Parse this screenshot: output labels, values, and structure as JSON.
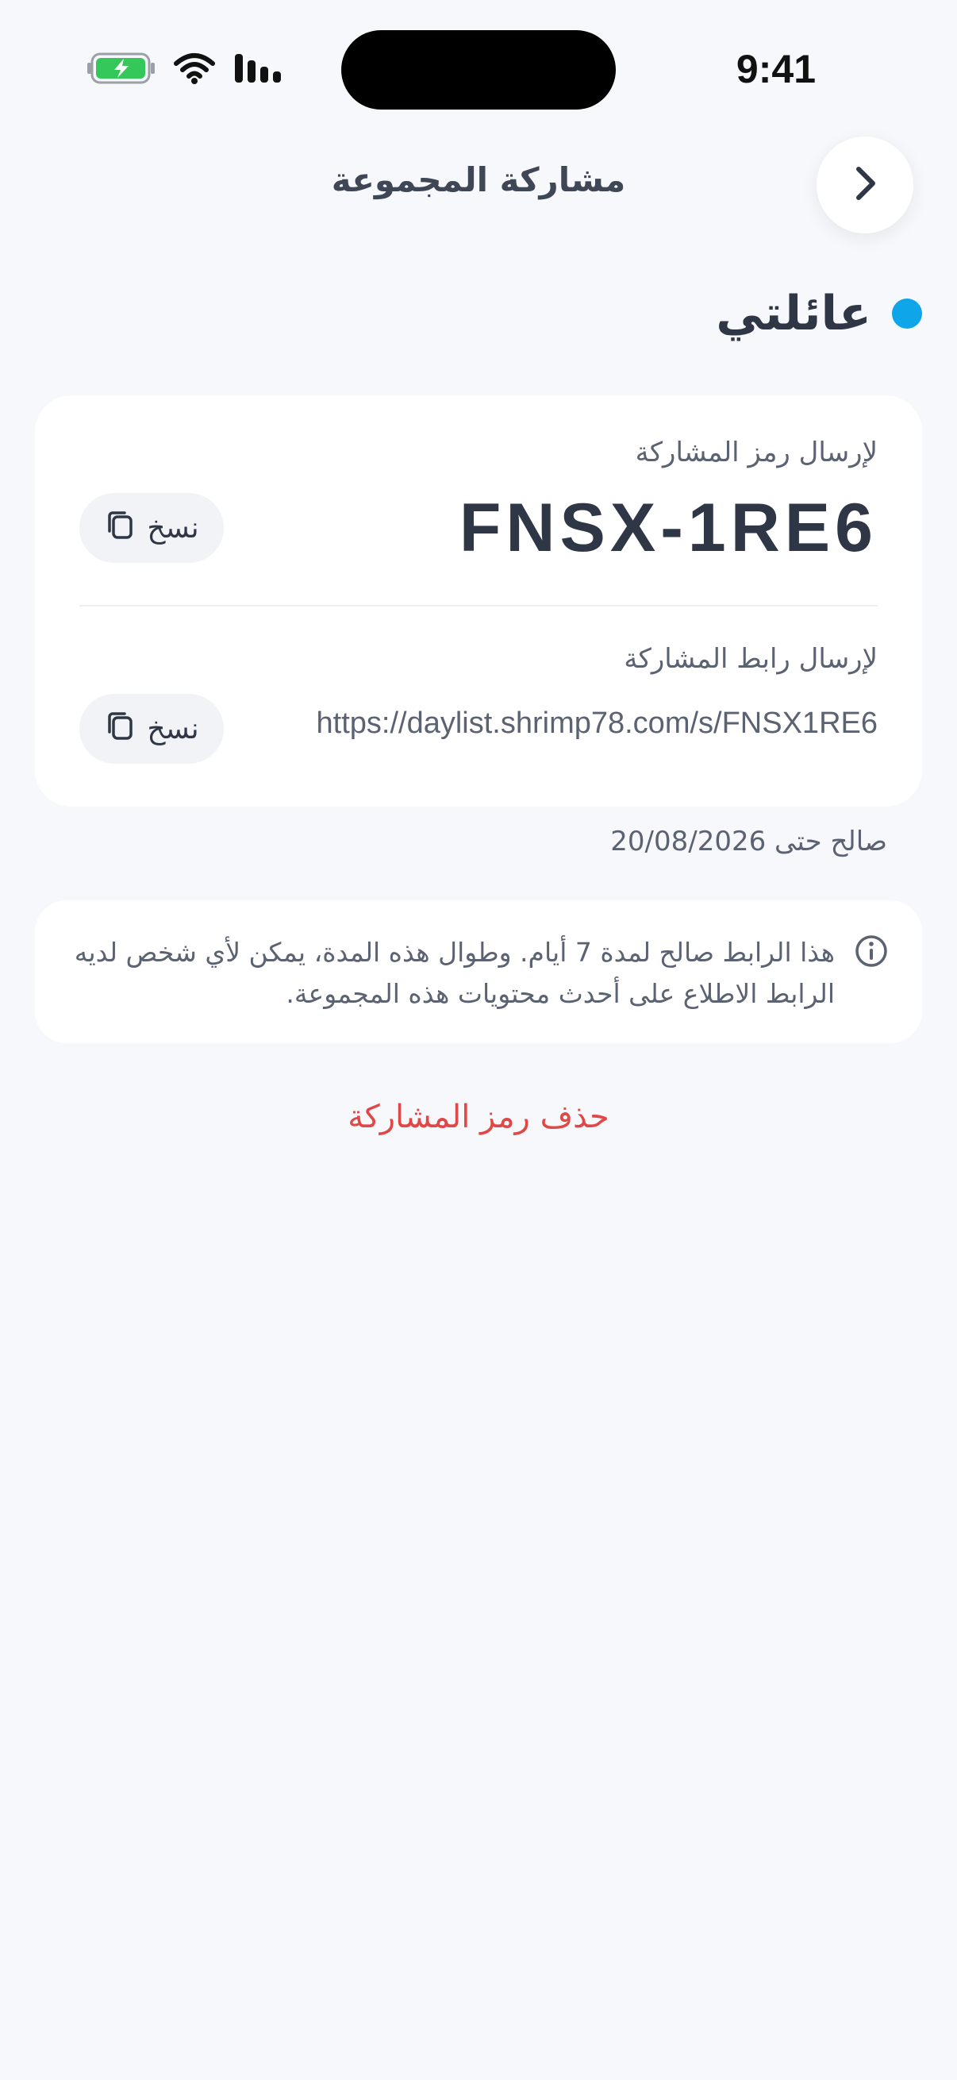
{
  "status_bar": {
    "time": "9:41"
  },
  "header": {
    "title": "مشاركة المجموعة"
  },
  "group": {
    "name": "عائلتي",
    "dot_color": "#0ea5e9"
  },
  "share": {
    "code_label": "لإرسال رمز المشاركة",
    "code": "FNSX-1RE6",
    "link_label": "لإرسال رابط المشاركة",
    "link": "https://daylist.shrimp78.com/s/FNSX1RE6",
    "copy_label": "نسخ"
  },
  "valid_until": "صالح حتى 20/08/2026",
  "info_text": "هذا الرابط صالح لمدة 7 أيام. وطوال هذه المدة، يمكن لأي شخص لديه الرابط الاطلاع على أحدث محتويات هذه المجموعة.",
  "delete_label": "حذف رمز المشاركة",
  "colors": {
    "danger": "#e04848",
    "accent": "#0ea5e9",
    "battery": "#34c759"
  }
}
